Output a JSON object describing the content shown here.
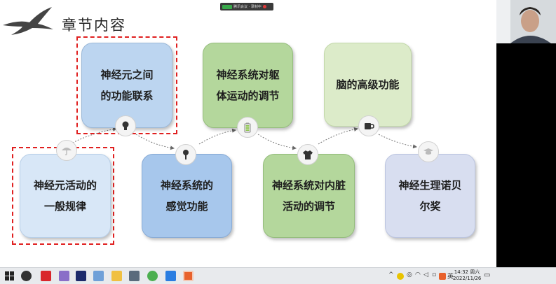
{
  "meeting": {
    "status": "腾讯会议 · 录制中"
  },
  "slide": {
    "title": "章节内容",
    "cards": {
      "card1": {
        "line1": "神经元之间",
        "line2": "的功能联系"
      },
      "card2": {
        "line1": "神经系统对躯",
        "line2": "体运动的调节"
      },
      "card3": {
        "line1": "脑的高级功能",
        "line2": ""
      },
      "card4": {
        "line1": "神经元活动的",
        "line2": "一般规律"
      },
      "card5": {
        "line1": "神经系统的",
        "line2": "感觉功能"
      },
      "card6": {
        "line1": "神经系统对内脏",
        "line2": "活动的调节"
      },
      "card7": {
        "line1": "神经生理诺贝",
        "line2": "尔奖"
      }
    },
    "icons": [
      "umbrella-icon",
      "lightbulb-icon",
      "key-icon",
      "battery-icon",
      "tshirt-icon",
      "coffee-cup-icon",
      "graduation-cap-icon"
    ]
  },
  "taskbar": {
    "apps": [
      "start",
      "app-1",
      "app-2",
      "app-3",
      "photoshop",
      "app-5",
      "file-explorer",
      "calculator",
      "app-8",
      "app-9",
      "powerpoint"
    ],
    "tray_lang": "英",
    "clock_time": "14:32 周六",
    "clock_date": "2022/11/26"
  },
  "colors": {
    "accent_red": "#e02020",
    "card_blue": "#bcd5f0",
    "card_green": "#b4d79c"
  }
}
